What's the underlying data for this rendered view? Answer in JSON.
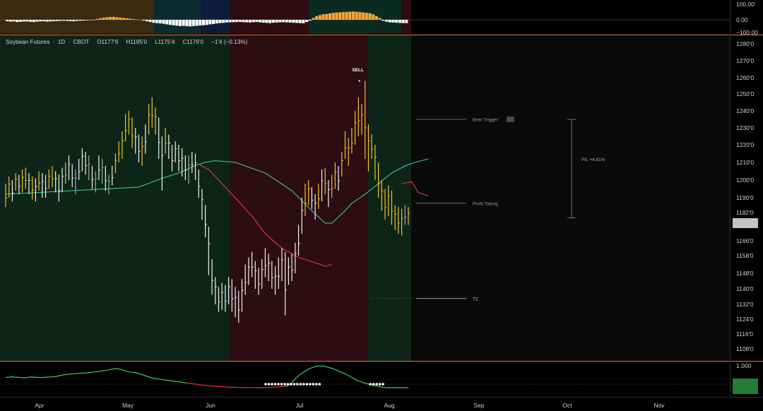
{
  "legend": {
    "symbol": "Soybean Futures",
    "interval": "1D",
    "exchange": "CBOT",
    "open": "O1177'6",
    "high": "H1185'0",
    "low": "L1175'4",
    "close": "C1176'0",
    "change": "−1'4 (−0.13%)"
  },
  "colors": {
    "background": "#000000",
    "zone_green": "#0d2519",
    "zone_red": "#2c0d14",
    "zone_dark": "#0a0a0a",
    "bar_yellow": "#f2c12e",
    "bar_white": "#f0f0f0",
    "bar_gray": "#a8a8a8",
    "ma_teal": "#3ec8a0",
    "ma_red": "#e8364a",
    "osc_green": "#46c85a",
    "osc_red": "#e83040",
    "hist_orange": "#f5a83a",
    "separator": "#e8742c",
    "axis_text": "#cfcfcf"
  },
  "chart_data": [
    {
      "type": "ohlc",
      "panel": "price",
      "y_axis_scale": "nonlinear (tick labels as printed)",
      "y_ticks": [
        "1280'0",
        "1270'0",
        "1260'0",
        "1250'0",
        "1240'0",
        "1230'0",
        "1220'0",
        "1210'0",
        "1200'0",
        "1190'0",
        "1182'0",
        "1166'0",
        "1158'0",
        "1148'0",
        "1140'0",
        "1132'0",
        "1124'0",
        "1116'0",
        "1108'0"
      ],
      "x_ticks": [
        "Apr",
        "May",
        "Jun",
        "Jul",
        "Aug",
        "Sep",
        "Oct",
        "Nov"
      ],
      "annotations": {
        "sell": "SELL",
        "bear_trigger": "Bear Trigger",
        "profit_taking": "Profit Taking",
        "target": "T1",
        "pnl": "P/L +4.81%"
      },
      "zones": [
        {
          "from": "Mar 13",
          "to": "Jun 04",
          "color": "green"
        },
        {
          "from": "Jun 04",
          "to": "Jul 17",
          "color": "red"
        },
        {
          "from": "Jul 17",
          "to": "Aug 06",
          "color": "green"
        }
      ],
      "levels": {
        "bear_trigger": 1235,
        "profit_taking": 1187,
        "t1": 1135,
        "pnl_top": 1235,
        "pnl_bottom": 1179
      },
      "bars": [
        [
          1198,
          1185,
          "y"
        ],
        [
          1202,
          1190,
          "y"
        ],
        [
          1200,
          1188,
          "w"
        ],
        [
          1204,
          1194,
          "y"
        ],
        [
          1203,
          1192,
          "w"
        ],
        [
          1206,
          1193,
          "y"
        ],
        [
          1207,
          1195,
          "y"
        ],
        [
          1204,
          1192,
          "w"
        ],
        [
          1202,
          1189,
          "y"
        ],
        [
          1201,
          1188,
          "w"
        ],
        [
          1205,
          1194,
          "y"
        ],
        [
          1204,
          1190,
          "w"
        ],
        [
          1203,
          1190,
          "w"
        ],
        [
          1206,
          1195,
          "y"
        ],
        [
          1208,
          1196,
          "y"
        ],
        [
          1205,
          1193,
          "w"
        ],
        [
          1203,
          1188,
          "w"
        ],
        [
          1207,
          1193,
          "w"
        ],
        [
          1210,
          1198,
          "y"
        ],
        [
          1214,
          1200,
          "w"
        ],
        [
          1209,
          1196,
          "w"
        ],
        [
          1206,
          1192,
          "g"
        ],
        [
          1212,
          1200,
          "w"
        ],
        [
          1218,
          1205,
          "w"
        ],
        [
          1216,
          1203,
          "w"
        ],
        [
          1214,
          1200,
          "g"
        ],
        [
          1208,
          1195,
          "w"
        ],
        [
          1205,
          1193,
          "g"
        ],
        [
          1214,
          1200,
          "w"
        ],
        [
          1212,
          1198,
          "g"
        ],
        [
          1208,
          1194,
          "w"
        ],
        [
          1203,
          1192,
          "g"
        ],
        [
          1208,
          1197,
          "w"
        ],
        [
          1215,
          1204,
          "y"
        ],
        [
          1222,
          1210,
          "y"
        ],
        [
          1228,
          1212,
          "y"
        ],
        [
          1238,
          1222,
          "y"
        ],
        [
          1240,
          1226,
          "y"
        ],
        [
          1236,
          1218,
          "y"
        ],
        [
          1230,
          1215,
          "w"
        ],
        [
          1226,
          1210,
          "w"
        ],
        [
          1225,
          1208,
          "y"
        ],
        [
          1232,
          1215,
          "w"
        ],
        [
          1244,
          1226,
          "y"
        ],
        [
          1248,
          1230,
          "y"
        ],
        [
          1242,
          1226,
          "y"
        ],
        [
          1236,
          1212,
          "w"
        ],
        [
          1225,
          1194,
          "w"
        ],
        [
          1230,
          1215,
          "y"
        ],
        [
          1226,
          1212,
          "w"
        ],
        [
          1220,
          1205,
          "w"
        ],
        [
          1222,
          1210,
          "w"
        ],
        [
          1220,
          1205,
          "w"
        ],
        [
          1218,
          1202,
          "w"
        ],
        [
          1214,
          1200,
          "w"
        ],
        [
          1214,
          1198,
          "g"
        ],
        [
          1216,
          1204,
          "w"
        ],
        [
          1215,
          1200,
          "w"
        ],
        [
          1206,
          1190,
          "w"
        ],
        [
          1195,
          1178,
          "w"
        ],
        [
          1186,
          1168,
          "w"
        ],
        [
          1174,
          1147,
          "w"
        ],
        [
          1156,
          1137,
          "w"
        ],
        [
          1146,
          1132,
          "w"
        ],
        [
          1141,
          1128,
          "w"
        ],
        [
          1143,
          1129,
          "w"
        ],
        [
          1142,
          1128,
          "w"
        ],
        [
          1146,
          1132,
          "w"
        ],
        [
          1145,
          1128,
          "w"
        ],
        [
          1141,
          1125,
          "w"
        ],
        [
          1139,
          1122,
          "w"
        ],
        [
          1145,
          1128,
          "w"
        ],
        [
          1153,
          1137,
          "w"
        ],
        [
          1157,
          1142,
          "w"
        ],
        [
          1160,
          1146,
          "w"
        ],
        [
          1155,
          1140,
          "w"
        ],
        [
          1151,
          1137,
          "w"
        ],
        [
          1156,
          1140,
          "w"
        ],
        [
          1162,
          1146,
          "w"
        ],
        [
          1159,
          1144,
          "w"
        ],
        [
          1155,
          1140,
          "w"
        ],
        [
          1152,
          1137,
          "w"
        ],
        [
          1157,
          1140,
          "w"
        ],
        [
          1162,
          1144,
          "w"
        ],
        [
          1160,
          1126,
          "w"
        ],
        [
          1157,
          1142,
          "w"
        ],
        [
          1159,
          1144,
          "w"
        ],
        [
          1165,
          1148,
          "w"
        ],
        [
          1175,
          1158,
          "w"
        ],
        [
          1190,
          1170,
          "w"
        ],
        [
          1198,
          1180,
          "y"
        ],
        [
          1200,
          1186,
          "y"
        ],
        [
          1196,
          1184,
          "w"
        ],
        [
          1192,
          1178,
          "w"
        ],
        [
          1198,
          1184,
          "y"
        ],
        [
          1206,
          1188,
          "w"
        ],
        [
          1207,
          1192,
          "y"
        ],
        [
          1200,
          1185,
          "w"
        ],
        [
          1203,
          1190,
          "y"
        ],
        [
          1210,
          1195,
          "y"
        ],
        [
          1208,
          1194,
          "w"
        ],
        [
          1216,
          1202,
          "y"
        ],
        [
          1228,
          1212,
          "y"
        ],
        [
          1224,
          1208,
          "y"
        ],
        [
          1230,
          1215,
          "y"
        ],
        [
          1240,
          1220,
          "y"
        ],
        [
          1248,
          1225,
          "y"
        ],
        [
          1244,
          1226,
          "y"
        ],
        [
          1258,
          1212,
          "y"
        ],
        [
          1232,
          1205,
          "y"
        ],
        [
          1226,
          1212,
          "y"
        ],
        [
          1220,
          1200,
          "y"
        ],
        [
          1210,
          1190,
          "y"
        ],
        [
          1200,
          1183,
          "y"
        ],
        [
          1195,
          1178,
          "y"
        ],
        [
          1197,
          1180,
          "y"
        ],
        [
          1194,
          1175,
          "y"
        ],
        [
          1186,
          1172,
          "y"
        ],
        [
          1185,
          1170,
          "y"
        ],
        [
          1184,
          1169,
          "y"
        ],
        [
          1186,
          1175,
          "g"
        ],
        [
          1185,
          1175,
          "y"
        ]
      ],
      "ma_teal": [
        [
          0,
          1192
        ],
        [
          20,
          1194
        ],
        [
          40,
          1196
        ],
        [
          47,
          1201
        ],
        [
          52,
          1204
        ],
        [
          58,
          1209
        ],
        [
          60,
          1210
        ],
        [
          63,
          1211
        ],
        [
          69,
          1210
        ],
        [
          78,
          1204
        ],
        [
          82,
          1199
        ],
        [
          86,
          1194
        ],
        [
          92,
          1183
        ],
        [
          96,
          1176
        ],
        [
          98,
          1176
        ],
        [
          102,
          1183
        ],
        [
          104,
          1187
        ],
        [
          108,
          1192
        ],
        [
          112,
          1198
        ],
        [
          116,
          1204
        ],
        [
          120,
          1208
        ],
        [
          123,
          1210
        ],
        [
          127,
          1212
        ]
      ],
      "ma_red": [
        [
          58,
          1209
        ],
        [
          61,
          1206
        ],
        [
          65,
          1198
        ],
        [
          69,
          1190
        ],
        [
          74,
          1180
        ],
        [
          78,
          1170
        ],
        [
          83,
          1162
        ],
        [
          88,
          1157
        ],
        [
          93,
          1154
        ],
        [
          96,
          1152
        ],
        [
          98,
          1153
        ]
      ],
      "ma_red_2": [
        [
          119,
          1198
        ],
        [
          122,
          1199
        ],
        [
          124,
          1193
        ],
        [
          127,
          1191
        ]
      ]
    },
    {
      "type": "bar",
      "panel": "histogram",
      "y_ticks": [
        "100.00",
        "0.00",
        "−100.00"
      ],
      "values": [
        -8,
        -10,
        -9,
        -12,
        -11,
        -10,
        -9,
        -11,
        -12,
        -10,
        -9,
        -8,
        -10,
        -9,
        -8,
        -7,
        -6,
        -5,
        -6,
        -7,
        -8,
        -6,
        -5,
        -4,
        -3,
        -2,
        -1,
        5,
        8,
        12,
        14,
        15,
        16,
        14,
        12,
        10,
        8,
        6,
        4,
        2,
        0,
        -4,
        -8,
        -12,
        -16,
        -18,
        -20,
        -22,
        -25,
        -28,
        -30,
        -32,
        -34,
        -33,
        -35,
        -36,
        -34,
        -33,
        -31,
        -30,
        -28,
        -25,
        -23,
        -20,
        -18,
        -17,
        -15,
        -14,
        -13,
        -12,
        -12,
        -13,
        -14,
        -15,
        -13,
        -12,
        -14,
        -16,
        -17,
        -18,
        -16,
        -15,
        -14,
        -13,
        -14,
        -15,
        -16,
        -17,
        -18,
        -19,
        -12,
        -5,
        10,
        20,
        25,
        30,
        32,
        35,
        38,
        40,
        41,
        42,
        43,
        44,
        45,
        44,
        42,
        40,
        38,
        36,
        30,
        20,
        10,
        -5,
        -10,
        -14,
        -15,
        -16,
        -17,
        -18,
        -18
      ],
      "positive_color": "orange",
      "negative_color": "white",
      "zones": [
        {
          "from": "Mar 13",
          "to": "Apr 17",
          "color": "brown"
        },
        {
          "from": "Apr 17",
          "to": "May 27",
          "color": "teal"
        },
        {
          "from": "May 27",
          "to": "Jun 04",
          "color": "navy"
        },
        {
          "from": "Jun 04",
          "to": "Jul 01",
          "color": "red"
        },
        {
          "from": "Jul 01",
          "to": "Jul 31",
          "color": "green"
        },
        {
          "from": "Jul 31",
          "to": "Aug 06",
          "color": "red"
        }
      ]
    },
    {
      "type": "line",
      "panel": "oscillator",
      "y_ticks": [
        "1.000"
      ],
      "values": [
        0.46,
        0.48,
        0.5,
        0.48,
        0.47,
        0.46,
        0.45,
        0.47,
        0.49,
        0.48,
        0.47,
        0.46,
        0.47,
        0.48,
        0.49,
        0.5,
        0.52,
        0.55,
        0.58,
        0.6,
        0.62,
        0.63,
        0.64,
        0.65,
        0.66,
        0.67,
        0.68,
        0.7,
        0.72,
        0.74,
        0.76,
        0.78,
        0.8,
        0.83,
        0.86,
        0.87,
        0.85,
        0.8,
        0.76,
        0.72,
        0.7,
        0.68,
        0.65,
        0.6,
        0.55,
        0.5,
        0.45,
        0.42,
        0.4,
        0.38,
        0.36,
        0.34,
        0.32,
        0.3,
        0.28,
        0.26,
        0.24,
        0.22,
        0.2,
        0.18,
        0.16,
        0.14,
        0.12,
        0.1,
        0.09,
        0.08,
        0.07,
        0.06,
        0.05,
        0.04,
        0.03,
        0.02,
        0.02,
        0.01,
        0.01,
        0.0,
        0.0,
        0.0,
        0.01,
        0.0,
        0.0,
        0.0,
        0.0,
        0.01,
        0.02,
        0.03,
        0.04,
        0.05,
        0.06,
        0.1,
        0.2,
        0.35,
        0.5,
        0.62,
        0.72,
        0.8,
        0.88,
        0.94,
        0.98,
        1.0,
        0.99,
        0.96,
        0.92,
        0.88,
        0.82,
        0.76,
        0.7,
        0.64,
        0.56,
        0.48,
        0.4,
        0.33,
        0.28,
        0.22,
        0.18,
        0.14,
        0.1,
        0.08,
        0.05,
        0.02,
        0.0,
        0.0,
        0.0,
        0.0,
        0.0,
        0.0,
        0.0,
        0.0
      ],
      "red_segment": [
        57,
        88
      ],
      "dot_ranges": [
        [
          82,
          99
        ],
        [
          115,
          119
        ]
      ],
      "dotted_level": 0.25
    }
  ]
}
